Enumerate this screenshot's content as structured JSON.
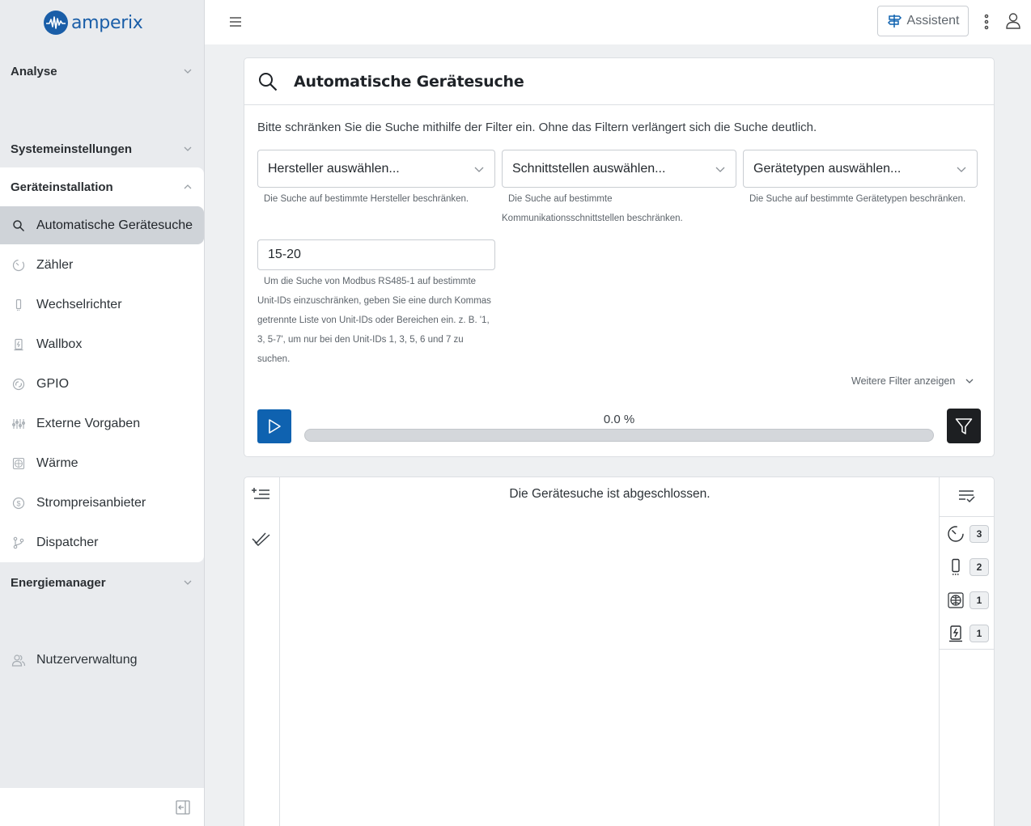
{
  "brand": {
    "name": "amperix"
  },
  "sidebar": {
    "sections": {
      "analyse": "Analyse",
      "system": "Systemeinstellungen",
      "install": "Geräteinstallation",
      "energy": "Energiemanager"
    },
    "items": [
      {
        "label": "Automatische Gerätesuche",
        "icon": "search-icon",
        "active": true
      },
      {
        "label": "Zähler",
        "icon": "meter-icon"
      },
      {
        "label": "Wechselrichter",
        "icon": "inverter-icon"
      },
      {
        "label": "Wallbox",
        "icon": "wallbox-icon"
      },
      {
        "label": "GPIO",
        "icon": "gpio-icon"
      },
      {
        "label": "Externe Vorgaben",
        "icon": "sliders-icon"
      },
      {
        "label": "Wärme",
        "icon": "heat-icon"
      },
      {
        "label": "Strompreisanbieter",
        "icon": "price-icon"
      },
      {
        "label": "Dispatcher",
        "icon": "dispatcher-icon"
      }
    ],
    "users": "Nutzerverwaltung"
  },
  "topbar": {
    "assistant_label": "Assistent"
  },
  "search": {
    "title": "Automatische Gerätesuche",
    "hint": "Bitte schränken Sie die Suche mithilfe der Filter ein. Ohne das Filtern verlängert sich die Suche deutlich.",
    "manufacturer": {
      "placeholder": "Hersteller auswählen...",
      "help": "Die Suche auf bestimmte Hersteller beschränken."
    },
    "interfaces": {
      "placeholder": "Schnittstellen auswählen...",
      "help": "Die Suche auf bestimmte Kommunikationsschnittstellen beschränken."
    },
    "device_types": {
      "placeholder": "Gerätetypen auswählen...",
      "help": "Die Suche auf bestimmte Gerätetypen beschränken."
    },
    "unit_ids": {
      "value": "15-20",
      "help": "Um die Suche von Modbus RS485-1 auf bestimmte Unit-IDs einzuschränken, geben Sie eine durch Kommas getrennte Liste von Unit-IDs oder Bereichen ein. z. B. '1, 3, 5-7', um nur bei den Unit-IDs 1, 3, 5, 6 und 7 zu suchen."
    },
    "more_filters": "Weitere Filter anzeigen",
    "progress": {
      "label": "0.0 %",
      "percent": 0
    }
  },
  "results": {
    "status": "Die Gerätesuche ist abgeschlossen.",
    "counts": [
      {
        "icon": "meter-icon",
        "count": "3"
      },
      {
        "icon": "inverter-icon",
        "count": "2"
      },
      {
        "icon": "heat-icon",
        "count": "1"
      },
      {
        "icon": "wallbox-icon",
        "count": "1"
      }
    ]
  },
  "colors": {
    "primary": "#0f62b0",
    "dark_button": "#1d1f22",
    "sidebar_bg": "#e9ebee",
    "active_item": "#cfd3d8"
  }
}
